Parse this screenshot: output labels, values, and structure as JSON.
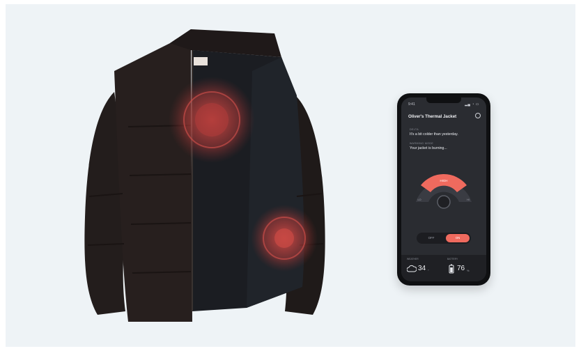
{
  "app": {
    "title": "Oliver's Thermal Jacket"
  },
  "status_bar": {
    "time": "9:41",
    "icons": "▂▄ ◔ ▭"
  },
  "messages": [
    {
      "label": "DELTA",
      "text": "It's a bit colder than yesterday."
    },
    {
      "label": "WARMING MODE",
      "text": "Your jacket is burning..."
    }
  ],
  "dial": {
    "level_label": "HIGH",
    "left_label": "LO",
    "right_label": "HI",
    "level_fraction": 0.8
  },
  "toggle": {
    "off_label": "OFF",
    "on_label": "ON"
  },
  "stats": {
    "weather_label": "WEATHER",
    "temperature": "34",
    "temperature_unit": "°",
    "battery_label": "BATTERY",
    "battery_value": "76",
    "battery_unit": "%"
  },
  "colors": {
    "accent": "#ef6a5e",
    "screen_bg": "#2a2c31",
    "jacket": "#231d1c"
  },
  "icons": {
    "settings": "gear-icon",
    "weather": "cloud-icon",
    "battery": "battery-icon"
  }
}
